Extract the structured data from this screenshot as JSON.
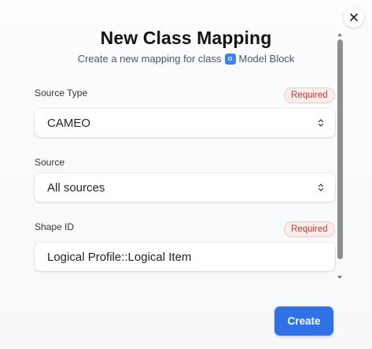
{
  "dialog": {
    "title": "New Class Mapping",
    "subtitle_prefix": "Create a new mapping for class",
    "class_name": "Model Block"
  },
  "fields": {
    "source_type": {
      "label": "Source Type",
      "required_badge": "Required",
      "value": "CAMEO"
    },
    "source": {
      "label": "Source",
      "value": "All sources"
    },
    "shape_id": {
      "label": "Shape ID",
      "required_badge": "Required",
      "value": "Logical Profile::Logical Item"
    }
  },
  "actions": {
    "create_label": "Create"
  },
  "icons": {
    "close": "close-icon",
    "chevron": "chevron-updown-icon",
    "class": "class-icon"
  },
  "colors": {
    "accent": "#2f72e8",
    "required_text": "#c0392b",
    "required_bg": "#fdecec"
  }
}
